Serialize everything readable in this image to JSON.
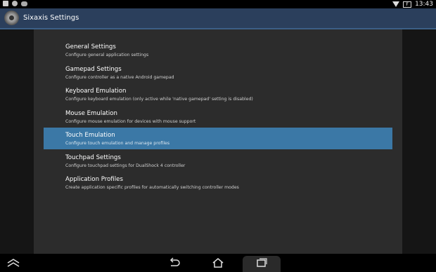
{
  "status_bar": {
    "icons": [
      "image-icon",
      "circle-icon",
      "gamepad-icon"
    ],
    "battery_label": "F",
    "time": "13:43"
  },
  "app": {
    "title": "Sixaxis Settings",
    "icon": "sixaxis-app-icon"
  },
  "settings": {
    "items": [
      {
        "title": "General Settings",
        "subtitle": "Configure general application settings",
        "selected": false
      },
      {
        "title": "Gamepad Settings",
        "subtitle": "Configure controller as a native Android gamepad",
        "selected": false
      },
      {
        "title": "Keyboard Emulation",
        "subtitle": "Configure keyboard emulation (only active while 'native gamepad' setting is disabled)",
        "selected": false
      },
      {
        "title": "Mouse Emulation",
        "subtitle": "Configure mouse emulation for devices with mouse support",
        "selected": false
      },
      {
        "title": "Touch Emulation",
        "subtitle": "Configure touch emulation and manage profiles",
        "selected": true
      },
      {
        "title": "Touchpad Settings",
        "subtitle": "Configure touchpad settings for DualShock 4 controller",
        "selected": false
      },
      {
        "title": "Application Profiles",
        "subtitle": "Create application specific profiles for automatically switching controller modes",
        "selected": false
      }
    ]
  },
  "nav_bar": {
    "buttons": [
      "chevron-up-icon",
      "back-icon",
      "home-icon",
      "recents-icon"
    ]
  },
  "colors": {
    "action_bar": "#2b3f5c",
    "selected_row": "#3b78a6",
    "panel": "#2c2c2c"
  }
}
